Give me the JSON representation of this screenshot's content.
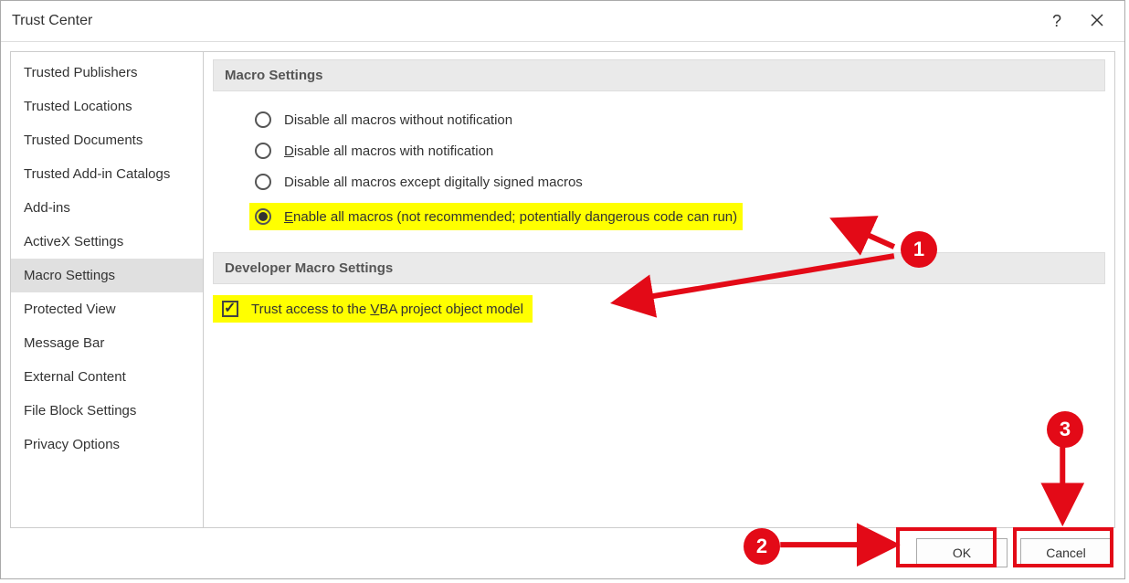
{
  "window": {
    "title": "Trust Center",
    "help_tooltip": "?",
    "close_tooltip": "Close"
  },
  "sidebar": {
    "items": [
      {
        "label": "Trusted Publishers"
      },
      {
        "label": "Trusted Locations"
      },
      {
        "label": "Trusted Documents"
      },
      {
        "label": "Trusted Add-in Catalogs"
      },
      {
        "label": "Add-ins"
      },
      {
        "label": "ActiveX Settings"
      },
      {
        "label": "Macro Settings",
        "selected": true
      },
      {
        "label": "Protected View"
      },
      {
        "label": "Message Bar"
      },
      {
        "label": "External Content"
      },
      {
        "label": "File Block Settings"
      },
      {
        "label": "Privacy Options"
      }
    ]
  },
  "sections": {
    "macro": {
      "header": "Macro Settings",
      "options": [
        {
          "label": "Disable all macros without notification",
          "checked": false
        },
        {
          "label_html": "<span class='u'>D</span>isable all macros with notification",
          "label": "Disable all macros with notification",
          "checked": false
        },
        {
          "label": "Disable all macros except digitally signed macros",
          "checked": false
        },
        {
          "label_html": "<span class='u'>E</span>nable all macros (not recommended; potentially dangerous code can run)",
          "label": "Enable all macros (not recommended; potentially dangerous code can run)",
          "checked": true,
          "highlighted": true
        }
      ]
    },
    "developer": {
      "header": "Developer Macro Settings",
      "options": [
        {
          "label_html": "Trust access to the <span class='u'>V</span>BA project object model",
          "label": "Trust access to the VBA project object model",
          "checked": true,
          "highlighted": true
        }
      ]
    }
  },
  "footer": {
    "ok": "OK",
    "cancel": "Cancel"
  },
  "annotations": {
    "circle1": "1",
    "circle2": "2",
    "circle3": "3"
  }
}
